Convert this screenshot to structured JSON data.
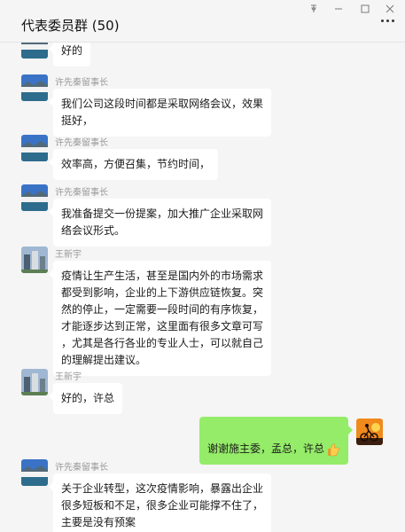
{
  "window": {
    "title": "代表委员群 (50)",
    "controls": {
      "pin_icon": "pin-icon",
      "minimize_icon": "minimize-icon",
      "maximize_icon": "maximize-icon",
      "close_icon": "close-icon"
    }
  },
  "header": {
    "more_icon": "more-icon"
  },
  "messages": [
    {
      "sender": "",
      "text": "好的",
      "avatar_icon": "lake-landscape-avatar"
    },
    {
      "sender": "许先秦留事长",
      "text": "我们公司这段时间都是采取网络会议，效果\n挺好，",
      "avatar_icon": "lake-landscape-avatar"
    },
    {
      "sender": "许先秦留事长",
      "text": "效率高，方便召集，节约时间，",
      "avatar_icon": "lake-landscape-avatar"
    },
    {
      "sender": "许先秦留事长",
      "text": "我准备提交一份提案，加大推广企业采取网\n络会议形式。",
      "avatar_icon": "lake-landscape-avatar"
    },
    {
      "sender": "王新宇",
      "text": "疫情让生产生活，甚至是国内外的市场需求\n都受到影响，企业的上下游供应链恢复。突\n然的停止，一定需要一段时间的有序恢复，\n才能逐步达到正常，这里面有很多文章可写\n，尤其是各行各业的专业人士，可以就自己\n的理解提出建议。",
      "avatar_icon": "building-avatar"
    },
    {
      "sender": "王新宇",
      "text": "好的，许总",
      "avatar_icon": "building-avatar"
    },
    {
      "sender": "",
      "text": "谢谢施主委，孟总，许总",
      "mine": true,
      "emoji": "thumbs-up-icon",
      "avatar_icon": "cyclist-sunset-avatar"
    },
    {
      "sender": "许先秦留事长",
      "text": "关于企业转型，这次疫情影响，暴露出企业\n很多短板和不足，很多企业可能撑不住了，\n主要是没有预案",
      "avatar_icon": "lake-landscape-avatar"
    }
  ]
}
